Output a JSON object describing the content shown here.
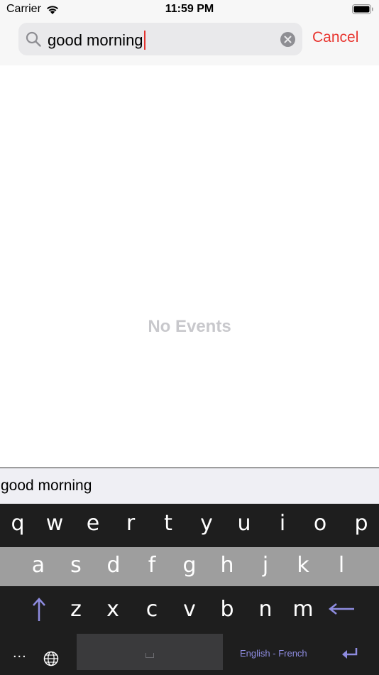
{
  "status_bar": {
    "carrier": "Carrier",
    "time": "11:59 PM",
    "icons": [
      "wifi-icon",
      "battery-icon"
    ]
  },
  "search": {
    "query": "good morning",
    "icon": "search-icon",
    "clear_icon": "clear-icon",
    "caret_color": "#e3342f",
    "cancel_label": "Cancel"
  },
  "content": {
    "empty_message": "No Events"
  },
  "suggestion": {
    "text": "good morning"
  },
  "keyboard": {
    "row1": [
      "q",
      "w",
      "e",
      "r",
      "t",
      "y",
      "u",
      "i",
      "o",
      "p"
    ],
    "row2": [
      "a",
      "s",
      "d",
      "f",
      "g",
      "h",
      "j",
      "k",
      "l"
    ],
    "row3": [
      "z",
      "x",
      "c",
      "v",
      "b",
      "n",
      "m"
    ],
    "more_label": "...",
    "language_label": "English - French",
    "icons": [
      "shift-icon",
      "backspace-icon",
      "globe-icon",
      "return-icon"
    ],
    "accent_color": "#8e8ce0"
  },
  "colors": {
    "accent": "#e8352f",
    "empty_text": "#c8c8cc",
    "keyboard_dark": "#1e1e1e",
    "keyboard_mid_row": "#9e9e9e"
  }
}
